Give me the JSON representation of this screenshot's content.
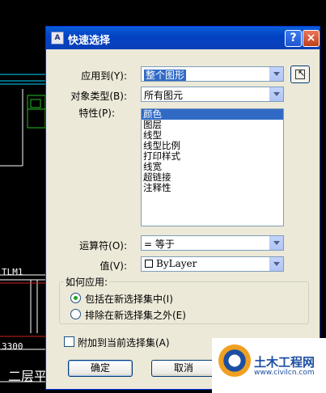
{
  "background": {
    "cad_labels": [
      "TLM1",
      "3300"
    ],
    "cad_title": "二层平"
  },
  "dialog": {
    "title": "快速选择",
    "title_icon": "A",
    "help_label": "?",
    "close_label": "×",
    "apply_to": {
      "label": "应用到(Y):",
      "value": "整个图形"
    },
    "object_type": {
      "label": "对象类型(B):",
      "value": "所有图元"
    },
    "properties": {
      "label": "特性(P):",
      "items": [
        "颜色",
        "图层",
        "线型",
        "线型比例",
        "打印样式",
        "线宽",
        "超链接",
        "注释性"
      ],
      "selected_index": 0
    },
    "operator": {
      "label": "运算符(O):",
      "value": "= 等于"
    },
    "value": {
      "label": "值(V):",
      "value": "ByLayer"
    },
    "how_to_apply": {
      "label": "如何应用:",
      "options": [
        "包括在新选择集中(I)",
        "排除在新选择集之外(E)"
      ],
      "selected_index": 0
    },
    "append_checkbox": {
      "label": "附加到当前选择集(A)",
      "checked": false
    },
    "buttons": {
      "ok": "确定",
      "cancel": "取消"
    }
  },
  "watermark": {
    "brand": "土木工程网",
    "url": "www.civilcn.com"
  },
  "colors": {
    "titlebar": "#0343c4",
    "dialog_bg": "#ece9d8",
    "selection": "#316ac5"
  }
}
